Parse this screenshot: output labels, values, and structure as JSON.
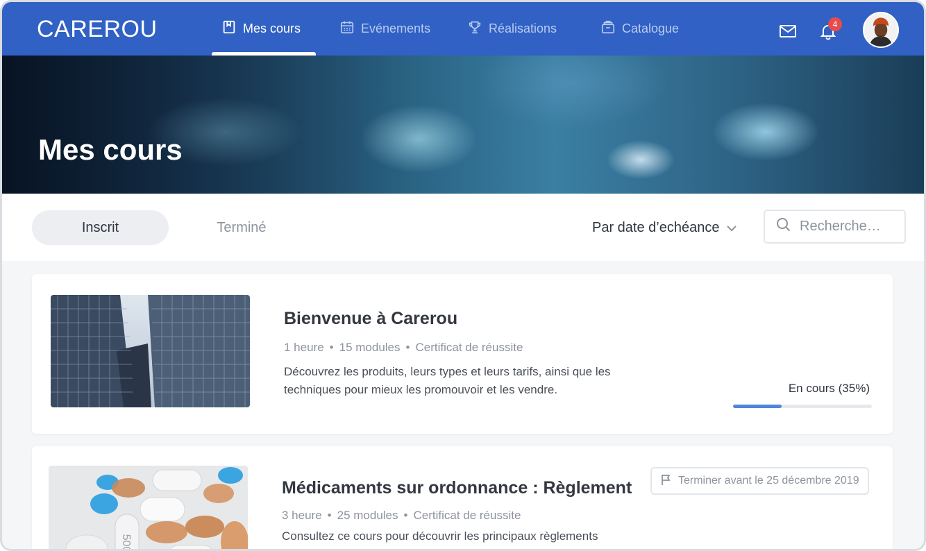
{
  "brand": {
    "logo_text": "CAREROU"
  },
  "nav": {
    "items": [
      {
        "label": "Mes cours",
        "icon": "book-icon",
        "active": true
      },
      {
        "label": "Evénements",
        "icon": "calendar-icon",
        "active": false
      },
      {
        "label": "Réalisations",
        "icon": "trophy-icon",
        "active": false
      },
      {
        "label": "Catalogue",
        "icon": "catalog-icon",
        "active": false
      }
    ],
    "notification_count": "4"
  },
  "hero": {
    "title": "Mes cours"
  },
  "filters": {
    "tabs": [
      {
        "label": "Inscrit",
        "selected": true
      },
      {
        "label": "Terminé",
        "selected": false
      }
    ],
    "sort_label": "Par date d’echéance",
    "search_placeholder": "Recherche…"
  },
  "courses": [
    {
      "title": "Bienvenue à Carerou",
      "duration": "1 heure",
      "modules": "15 modules",
      "certificate": "Certificat de réussite",
      "description": "Découvrez les produits, leurs types et leurs tarifs, ainsi que les techniques pour mieux les promouvoir et les vendre.",
      "status": "En cours (35%)",
      "progress": 0.35
    },
    {
      "title": "Médicaments sur ordonnance : Règlement",
      "duration": "3 heure",
      "modules": "25 modules",
      "certificate": "Certificat de réussite",
      "description": "Consultez ce cours pour découvrir les principaux règlements",
      "deadline": "Terminer avant le 25 décembre 2019"
    }
  ],
  "colors": {
    "nav_bg": "#3161c4",
    "accent": "#4f86de",
    "badge": "#e94b4b"
  }
}
